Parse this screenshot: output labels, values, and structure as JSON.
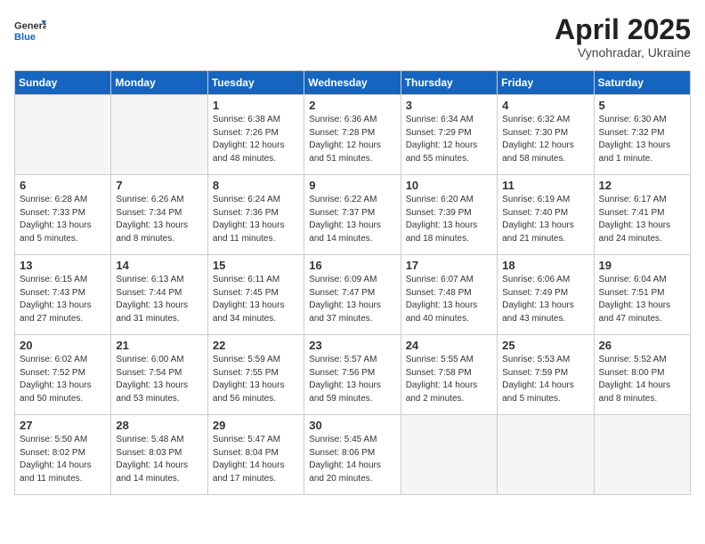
{
  "header": {
    "logo_general": "General",
    "logo_blue": "Blue",
    "month_title": "April 2025",
    "subtitle": "Vynohradar, Ukraine"
  },
  "days_of_week": [
    "Sunday",
    "Monday",
    "Tuesday",
    "Wednesday",
    "Thursday",
    "Friday",
    "Saturday"
  ],
  "weeks": [
    [
      {
        "day": "",
        "info": ""
      },
      {
        "day": "",
        "info": ""
      },
      {
        "day": "1",
        "info": "Sunrise: 6:38 AM\nSunset: 7:26 PM\nDaylight: 12 hours and 48 minutes."
      },
      {
        "day": "2",
        "info": "Sunrise: 6:36 AM\nSunset: 7:28 PM\nDaylight: 12 hours and 51 minutes."
      },
      {
        "day": "3",
        "info": "Sunrise: 6:34 AM\nSunset: 7:29 PM\nDaylight: 12 hours and 55 minutes."
      },
      {
        "day": "4",
        "info": "Sunrise: 6:32 AM\nSunset: 7:30 PM\nDaylight: 12 hours and 58 minutes."
      },
      {
        "day": "5",
        "info": "Sunrise: 6:30 AM\nSunset: 7:32 PM\nDaylight: 13 hours and 1 minute."
      }
    ],
    [
      {
        "day": "6",
        "info": "Sunrise: 6:28 AM\nSunset: 7:33 PM\nDaylight: 13 hours and 5 minutes."
      },
      {
        "day": "7",
        "info": "Sunrise: 6:26 AM\nSunset: 7:34 PM\nDaylight: 13 hours and 8 minutes."
      },
      {
        "day": "8",
        "info": "Sunrise: 6:24 AM\nSunset: 7:36 PM\nDaylight: 13 hours and 11 minutes."
      },
      {
        "day": "9",
        "info": "Sunrise: 6:22 AM\nSunset: 7:37 PM\nDaylight: 13 hours and 14 minutes."
      },
      {
        "day": "10",
        "info": "Sunrise: 6:20 AM\nSunset: 7:39 PM\nDaylight: 13 hours and 18 minutes."
      },
      {
        "day": "11",
        "info": "Sunrise: 6:19 AM\nSunset: 7:40 PM\nDaylight: 13 hours and 21 minutes."
      },
      {
        "day": "12",
        "info": "Sunrise: 6:17 AM\nSunset: 7:41 PM\nDaylight: 13 hours and 24 minutes."
      }
    ],
    [
      {
        "day": "13",
        "info": "Sunrise: 6:15 AM\nSunset: 7:43 PM\nDaylight: 13 hours and 27 minutes."
      },
      {
        "day": "14",
        "info": "Sunrise: 6:13 AM\nSunset: 7:44 PM\nDaylight: 13 hours and 31 minutes."
      },
      {
        "day": "15",
        "info": "Sunrise: 6:11 AM\nSunset: 7:45 PM\nDaylight: 13 hours and 34 minutes."
      },
      {
        "day": "16",
        "info": "Sunrise: 6:09 AM\nSunset: 7:47 PM\nDaylight: 13 hours and 37 minutes."
      },
      {
        "day": "17",
        "info": "Sunrise: 6:07 AM\nSunset: 7:48 PM\nDaylight: 13 hours and 40 minutes."
      },
      {
        "day": "18",
        "info": "Sunrise: 6:06 AM\nSunset: 7:49 PM\nDaylight: 13 hours and 43 minutes."
      },
      {
        "day": "19",
        "info": "Sunrise: 6:04 AM\nSunset: 7:51 PM\nDaylight: 13 hours and 47 minutes."
      }
    ],
    [
      {
        "day": "20",
        "info": "Sunrise: 6:02 AM\nSunset: 7:52 PM\nDaylight: 13 hours and 50 minutes."
      },
      {
        "day": "21",
        "info": "Sunrise: 6:00 AM\nSunset: 7:54 PM\nDaylight: 13 hours and 53 minutes."
      },
      {
        "day": "22",
        "info": "Sunrise: 5:59 AM\nSunset: 7:55 PM\nDaylight: 13 hours and 56 minutes."
      },
      {
        "day": "23",
        "info": "Sunrise: 5:57 AM\nSunset: 7:56 PM\nDaylight: 13 hours and 59 minutes."
      },
      {
        "day": "24",
        "info": "Sunrise: 5:55 AM\nSunset: 7:58 PM\nDaylight: 14 hours and 2 minutes."
      },
      {
        "day": "25",
        "info": "Sunrise: 5:53 AM\nSunset: 7:59 PM\nDaylight: 14 hours and 5 minutes."
      },
      {
        "day": "26",
        "info": "Sunrise: 5:52 AM\nSunset: 8:00 PM\nDaylight: 14 hours and 8 minutes."
      }
    ],
    [
      {
        "day": "27",
        "info": "Sunrise: 5:50 AM\nSunset: 8:02 PM\nDaylight: 14 hours and 11 minutes."
      },
      {
        "day": "28",
        "info": "Sunrise: 5:48 AM\nSunset: 8:03 PM\nDaylight: 14 hours and 14 minutes."
      },
      {
        "day": "29",
        "info": "Sunrise: 5:47 AM\nSunset: 8:04 PM\nDaylight: 14 hours and 17 minutes."
      },
      {
        "day": "30",
        "info": "Sunrise: 5:45 AM\nSunset: 8:06 PM\nDaylight: 14 hours and 20 minutes."
      },
      {
        "day": "",
        "info": ""
      },
      {
        "day": "",
        "info": ""
      },
      {
        "day": "",
        "info": ""
      }
    ]
  ]
}
